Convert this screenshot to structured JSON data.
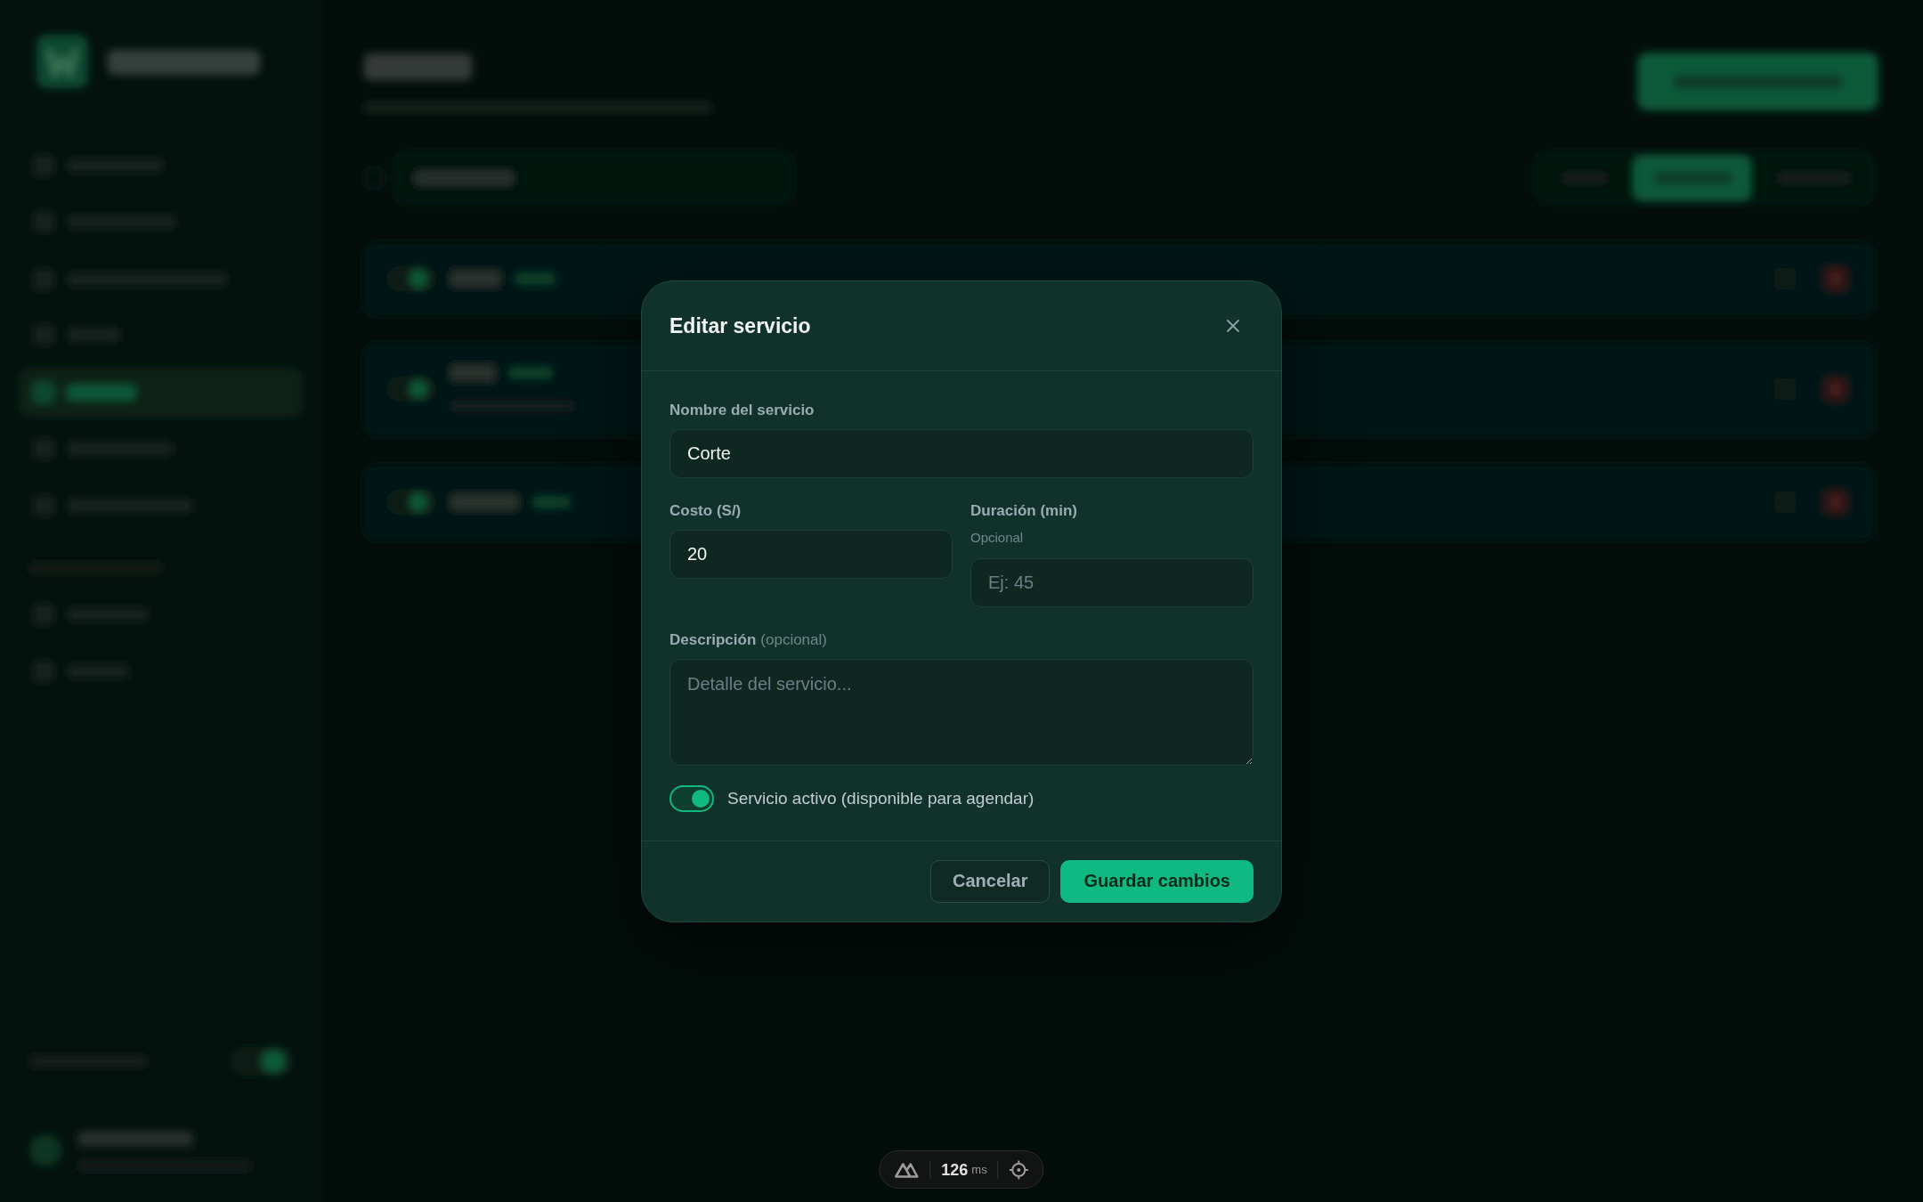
{
  "dialog": {
    "title": "Editar servicio",
    "rows": [
      [
        {
          "kind": "input",
          "label": "Nombre del servicio",
          "value": "Corte"
        }
      ],
      [
        {
          "kind": "input",
          "label": "Costo (S/)",
          "value": "20"
        },
        {
          "kind": "input",
          "label": "Duración (min)",
          "hint": "Opcional",
          "placeholder": "Ej: 45"
        }
      ],
      [
        {
          "kind": "textarea",
          "label": "Descripción",
          "label_note": "(opcional)",
          "placeholder": "Detalle del servicio..."
        }
      ]
    ],
    "toggle": {
      "label": "Servicio activo (disponible para agendar)",
      "on": true
    },
    "buttons": [
      {
        "kind": "secondary",
        "label": "Cancelar"
      },
      {
        "kind": "primary",
        "label": "Guardar cambios"
      }
    ]
  },
  "devtools": {
    "timing": "126",
    "unit": "ms"
  }
}
